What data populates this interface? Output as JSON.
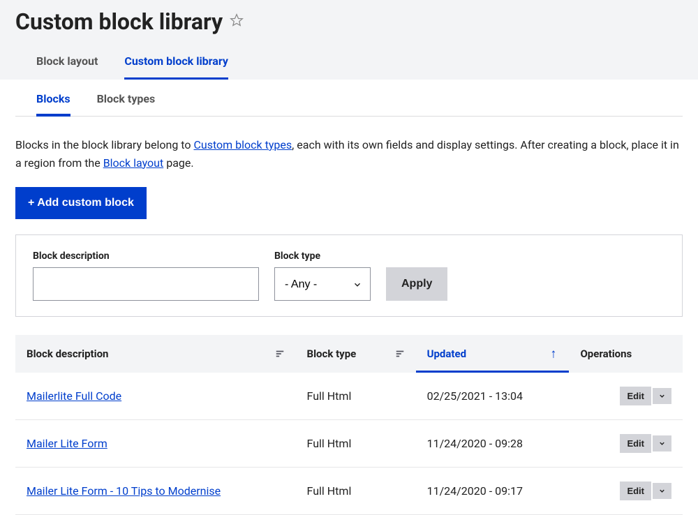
{
  "page": {
    "title": "Custom block library"
  },
  "tabs": {
    "primary": [
      {
        "label": "Block layout"
      },
      {
        "label": "Custom block library"
      }
    ],
    "secondary": [
      {
        "label": "Blocks"
      },
      {
        "label": "Block types"
      }
    ]
  },
  "description": {
    "part1": "Blocks in the block library belong to ",
    "link1": "Custom block types",
    "part2": ", each with its own fields and display settings. After creating a block, place it in a region from the ",
    "link2": "Block layout",
    "part3": " page."
  },
  "buttons": {
    "add": "+ Add custom block",
    "apply": "Apply",
    "edit": "Edit"
  },
  "filters": {
    "description_label": "Block description",
    "type_label": "Block type",
    "type_value": "- Any -",
    "description_value": ""
  },
  "table": {
    "headers": {
      "description": "Block description",
      "type": "Block type",
      "updated": "Updated",
      "operations": "Operations"
    },
    "rows": [
      {
        "description": "Mailerlite Full Code",
        "type": "Full Html",
        "updated": "02/25/2021 - 13:04"
      },
      {
        "description": "Mailer Lite Form",
        "type": "Full Html",
        "updated": "11/24/2020 - 09:28"
      },
      {
        "description": "Mailer Lite Form - 10 Tips to Modernise",
        "type": "Full Html",
        "updated": "11/24/2020 - 09:17"
      }
    ]
  }
}
